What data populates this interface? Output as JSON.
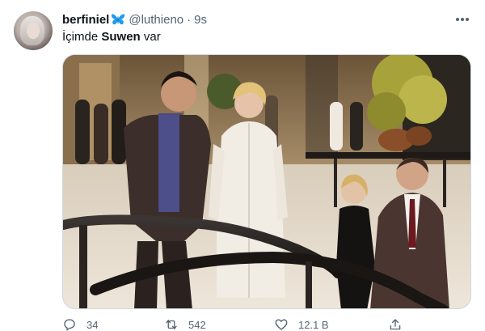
{
  "tweet": {
    "author": {
      "display_name": "berfiniel",
      "verified_emoji": "butterfly-icon",
      "handle": "@luthieno",
      "separator": "·",
      "time": "9s"
    },
    "text": {
      "prefix": "İçimde ",
      "bold": "Suwen",
      "suffix": " var"
    },
    "actions": {
      "reply_count": "34",
      "retweet_count": "542",
      "like_count": "12.1 B"
    }
  },
  "colors": {
    "text_primary": "#0f1419",
    "text_secondary": "#536471",
    "border": "#cfd9de",
    "butterfly": "#1d9bf0"
  }
}
